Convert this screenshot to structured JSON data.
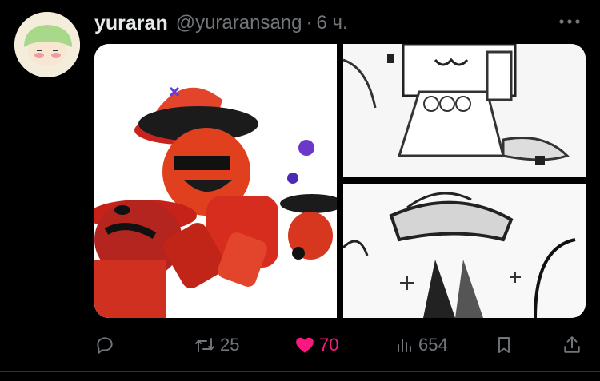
{
  "tweet": {
    "author_name": "yuraran",
    "author_handle": "@yuraransang",
    "separator": "·",
    "time": "6 ч."
  },
  "actions": {
    "reply_count": "",
    "retweet_count": "25",
    "like_count": "70",
    "views_count": "654"
  },
  "colors": {
    "background": "#000000",
    "text_primary": "#e7e9ea",
    "text_secondary": "#71767b",
    "like_active": "#f91880"
  },
  "icons": [
    "more-icon",
    "reply-icon",
    "retweet-icon",
    "heart-icon",
    "views-icon",
    "bookmark-icon",
    "share-icon"
  ]
}
